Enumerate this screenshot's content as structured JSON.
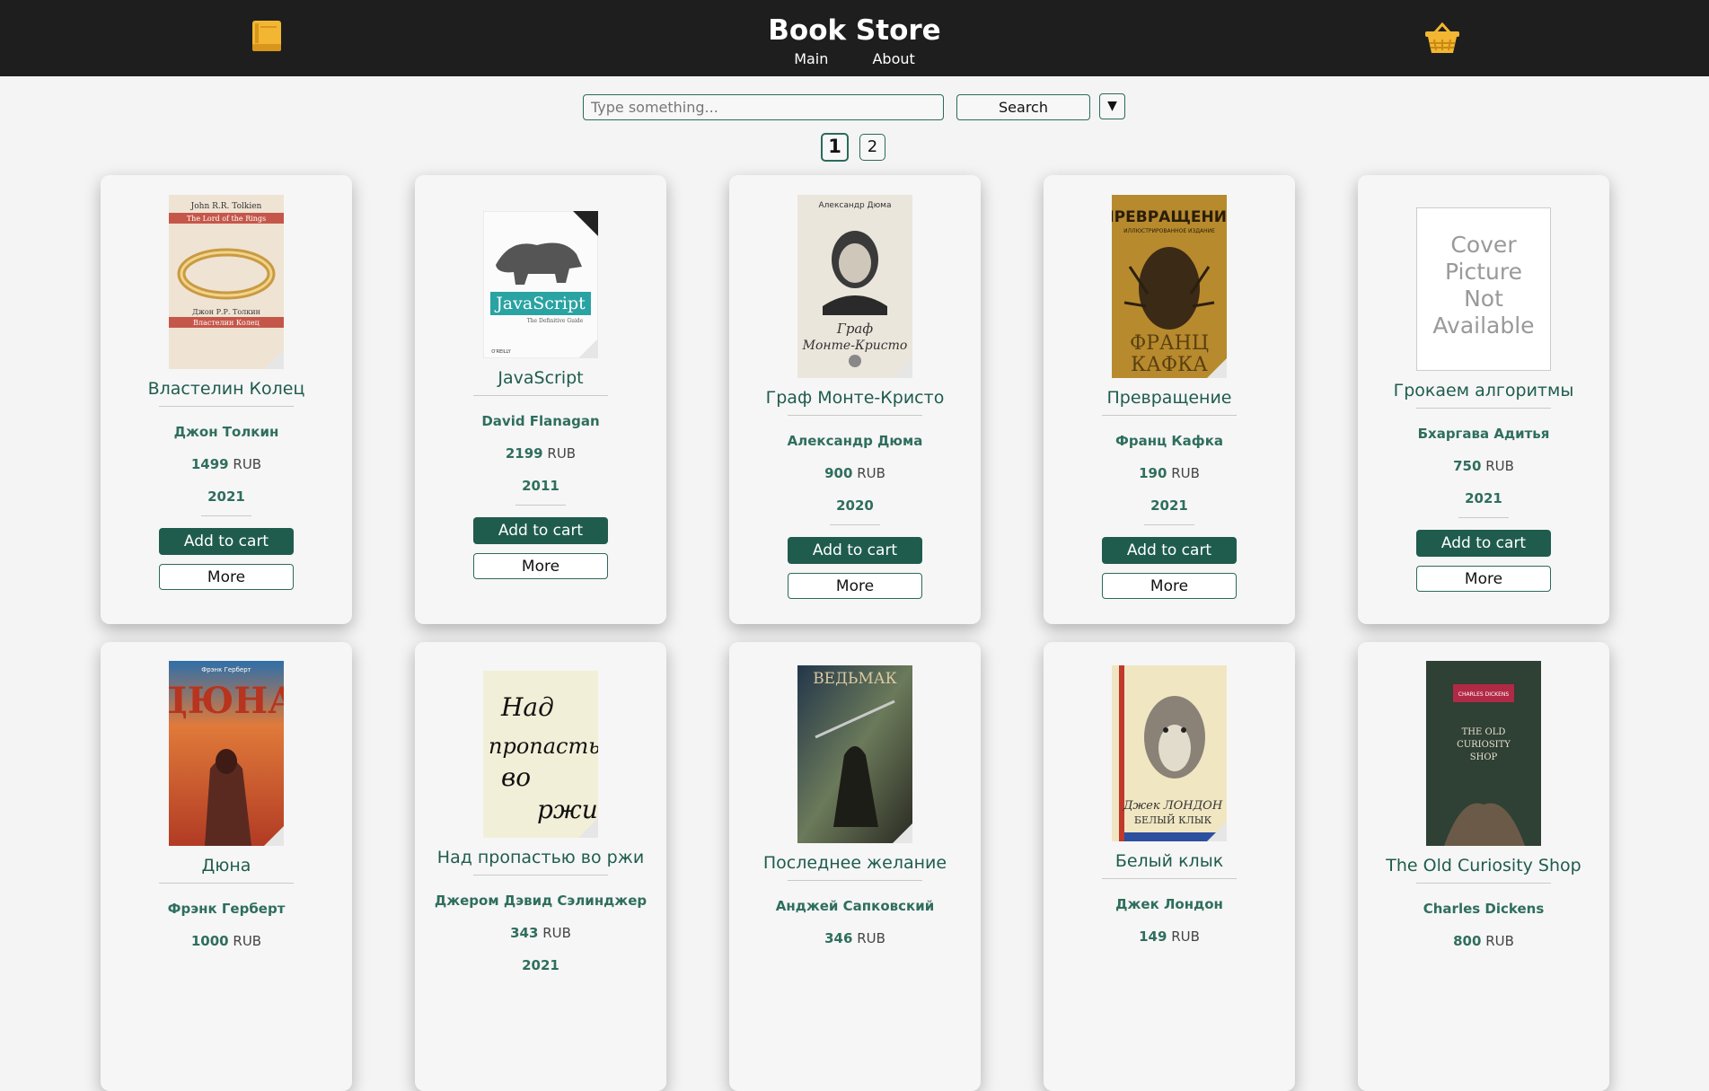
{
  "header": {
    "title": "Book Store",
    "nav": [
      "Main",
      "About"
    ]
  },
  "search": {
    "placeholder": "Type something...",
    "button_label": "Search",
    "sort_label": "▼"
  },
  "pagination": {
    "pages": [
      "1",
      "2"
    ],
    "current": "1"
  },
  "card_labels": {
    "add": "Add to cart",
    "more": "More"
  },
  "colors": {
    "accent": "#1f5c4d",
    "header_bg": "#1e1e1e",
    "page_bg": "#f4f4f4"
  },
  "books": [
    {
      "title": "Властелин Колец",
      "author": "Джон Толкин",
      "price": "1499",
      "currency": "RUB",
      "year": "2021",
      "cover_text": [
        "John R.R. Tolkien",
        "The Lord of the Rings",
        "Джон Р.Р. Толкин",
        "Властелин Колец"
      ]
    },
    {
      "title": "JavaScript",
      "author": "David Flanagan",
      "price": "2199",
      "currency": "RUB",
      "year": "2011",
      "cover_text": [
        "JavaScript",
        "The Definitive Guide",
        "O'REILLY"
      ]
    },
    {
      "title": "Граф Монте-Кристо",
      "author": "Александр Дюма",
      "price": "900",
      "currency": "RUB",
      "year": "2020",
      "cover_text": [
        "Александр Дюма",
        "Граф",
        "Монте-Кристо"
      ]
    },
    {
      "title": "Превращение",
      "author": "Франц Кафка",
      "price": "190",
      "currency": "RUB",
      "year": "2021",
      "cover_text": [
        "ПРЕВРАЩЕНИЕ",
        "ИЛЛЮСТРИРОВАННОЕ ИЗДАНИЕ",
        "ФРАНЦ",
        "КАФКА"
      ]
    },
    {
      "title": "Грокаем алгоритмы",
      "author": "Бхаргава Адитья",
      "price": "750",
      "currency": "RUB",
      "year": "2021",
      "cover_text": [
        "Cover",
        "Picture",
        "Not",
        "Available"
      ]
    },
    {
      "title": "Дюна",
      "author": "Фрэнк Герберт",
      "price": "1000",
      "currency": "RUB",
      "year": "",
      "cover_text": [
        "Фрэнк Герберт",
        "ДЮНА"
      ]
    },
    {
      "title": "Над пропастью во ржи",
      "author": "Джером Дэвид Сэлинджер",
      "price": "343",
      "currency": "RUB",
      "year": "2021",
      "cover_text": [
        "Над",
        "пропастью",
        "во",
        "ржи"
      ]
    },
    {
      "title": "Последнее желание",
      "author": "Анджей Сапковский",
      "price": "346",
      "currency": "RUB",
      "year": "",
      "cover_text": [
        "ВЕДЬМАК"
      ]
    },
    {
      "title": "Белый клык",
      "author": "Джек Лондон",
      "price": "149",
      "currency": "RUB",
      "year": "",
      "cover_text": [
        "Джек ЛОНДОН",
        "БЕЛЫЙ КЛЫК"
      ]
    },
    {
      "title": "The Old Curiosity Shop",
      "author": "Charles Dickens",
      "price": "800",
      "currency": "RUB",
      "year": "",
      "cover_text": [
        "CHARLES DICKENS",
        "THE OLD",
        "CURIOSITY",
        "SHOP"
      ]
    }
  ]
}
